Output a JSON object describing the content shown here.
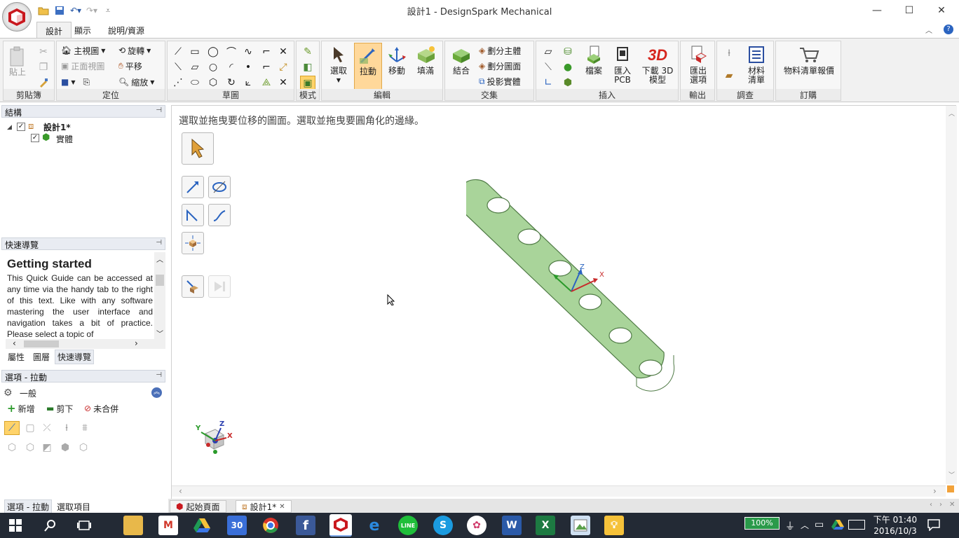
{
  "window": {
    "title": "設計1 - DesignSpark Mechanical"
  },
  "ribbon_tabs": [
    "設計",
    "顯示",
    "說明/資源"
  ],
  "groups": {
    "clipboard": {
      "label": "剪貼簿",
      "paste": "貼上"
    },
    "orient": {
      "label": "定位",
      "home": "主視圖",
      "front": "正面視圖",
      "spin": "旋轉",
      "pan": "平移",
      "zoom": "縮放"
    },
    "sketch": {
      "label": "草圖"
    },
    "mode": {
      "label": "模式"
    },
    "edit": {
      "label": "編輯",
      "select": "選取",
      "pull": "拉動",
      "move": "移動",
      "fill": "填滿"
    },
    "intersect": {
      "label": "交集",
      "combine": "結合",
      "split_body": "劃分主體",
      "split_face": "劃分圖面",
      "project": "投影實體"
    },
    "insert": {
      "label": "插入",
      "file": "檔案",
      "pcb": "匯入\nPCB",
      "download3d": "下載 3D\n模型",
      "badge3d": "3D"
    },
    "output": {
      "label": "輸出",
      "export": "匯出\n選項"
    },
    "investigate": {
      "label": "調查",
      "bom": "材料\n清單"
    },
    "order": {
      "label": "訂購",
      "quote": "物料清單報價"
    }
  },
  "structure": {
    "title": "結構",
    "root": "設計1*",
    "child": "實體"
  },
  "quick_guide": {
    "title": "快速導覽",
    "heading": "Getting started",
    "body": "This Quick Guide can be accessed at any time via the handy tab to the right of this text. Like with any software mastering the user interface and navigation takes a bit of practice. Please select a topic of"
  },
  "panel_tabs": [
    "屬性",
    "圖層",
    "快速導覽"
  ],
  "options": {
    "title": "選項 - 拉動",
    "section": "一般",
    "add": "新增",
    "cut": "剪下",
    "no_merge": "未合併"
  },
  "bottom_left_tabs": [
    "選項 - 拉動",
    "選取項目"
  ],
  "viewport": {
    "hint": "選取並拖曳要位移的圖面。選取並拖曳要圓角化的邊緣。",
    "triad": {
      "x": "X",
      "y": "Y",
      "z": "Z"
    }
  },
  "doc_tabs": [
    "起始頁面",
    "設計1*"
  ],
  "taskbar": {
    "battery": "100%",
    "time": "下午 01:40",
    "date": "2016/10/3",
    "calendar_day": "30",
    "word": "W",
    "excel": "X"
  },
  "colors": {
    "part_fill": "#a9d49a",
    "part_edge": "#4f7a45",
    "accent": "#2b64c0"
  }
}
